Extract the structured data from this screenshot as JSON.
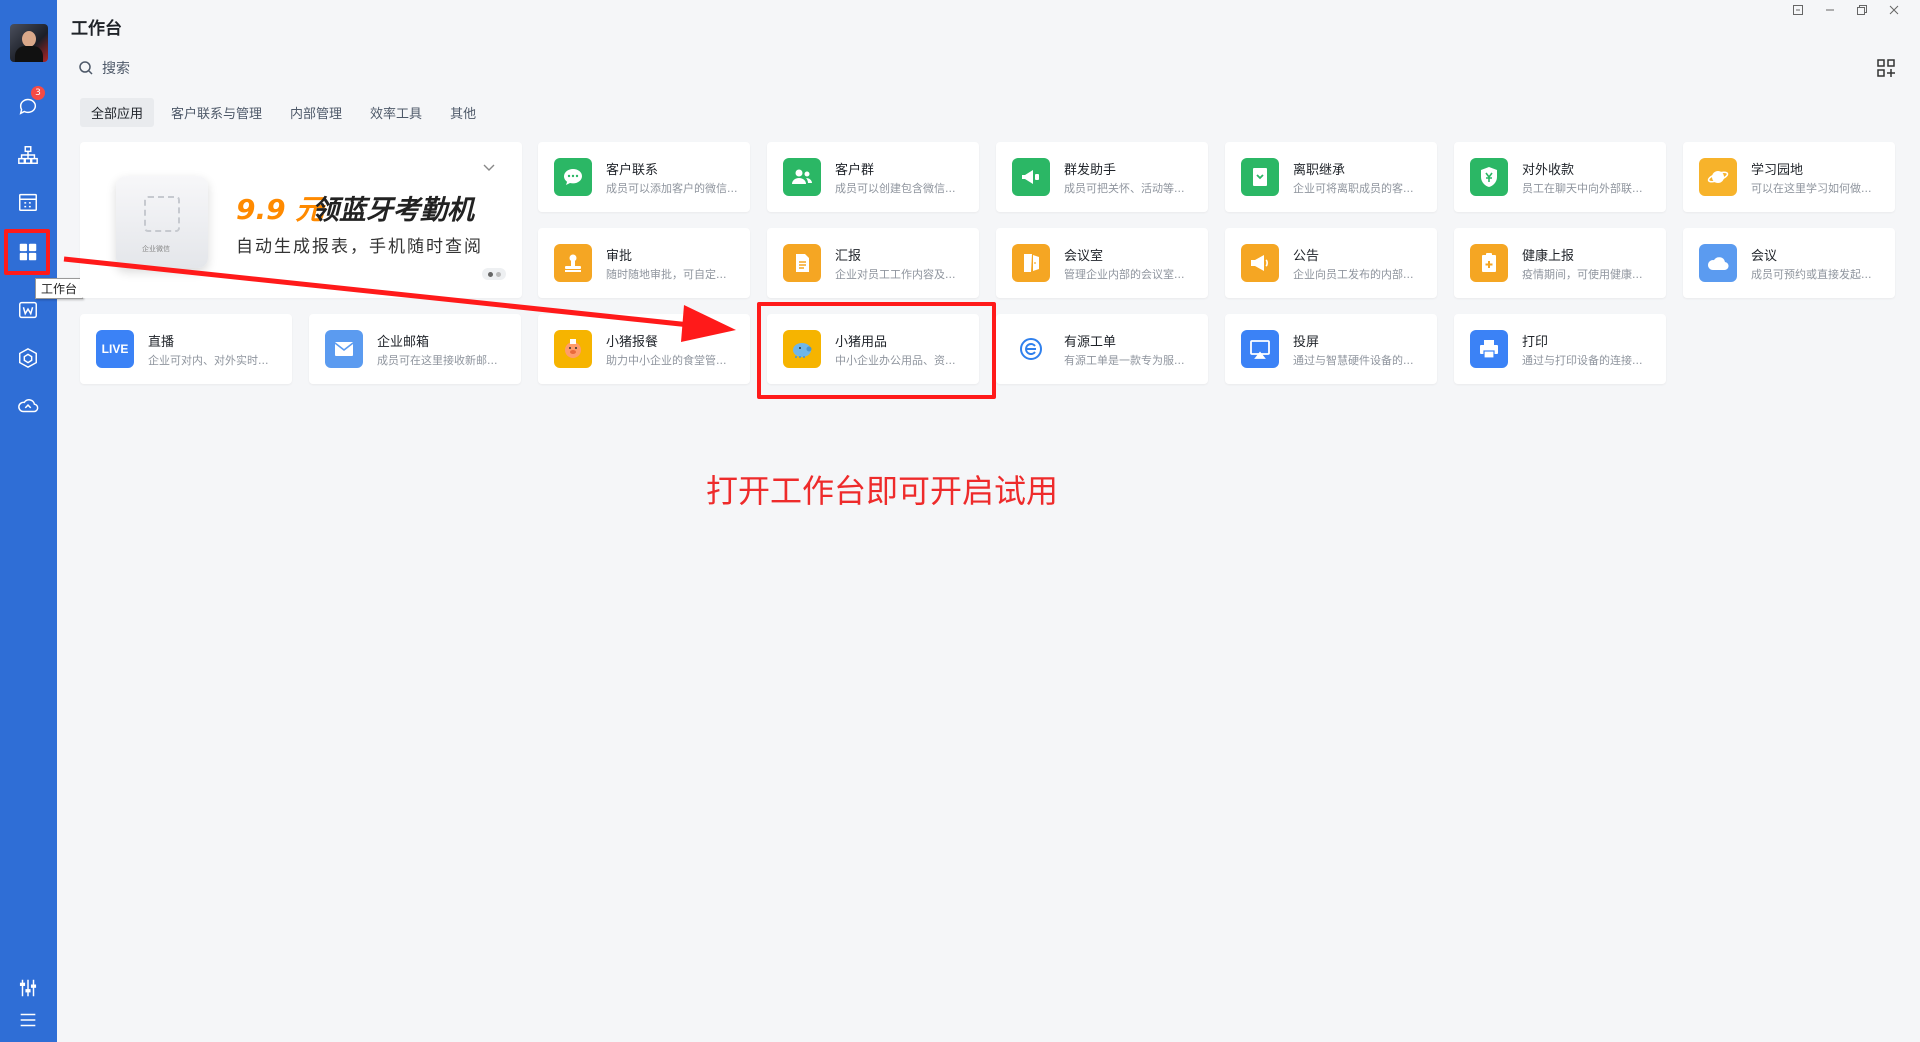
{
  "window": {
    "title": "工作台",
    "controls": [
      "pin",
      "minimize",
      "restore",
      "close"
    ]
  },
  "sidebar": {
    "badge_count": "3",
    "tooltip": "工作台",
    "items": [
      {
        "name": "messages-icon"
      },
      {
        "name": "contacts-icon"
      },
      {
        "name": "calendar-icon"
      },
      {
        "name": "workbench-icon",
        "active": true
      },
      {
        "name": "docs-icon"
      },
      {
        "name": "cube-icon"
      },
      {
        "name": "cloud-icon"
      },
      {
        "name": "settings-icon"
      },
      {
        "name": "menu-icon"
      }
    ]
  },
  "search": {
    "placeholder": "搜索"
  },
  "tabs": [
    "全部应用",
    "客户联系与管理",
    "内部管理",
    "效率工具",
    "其他"
  ],
  "banner": {
    "price": "9.9 元",
    "headline": "领蓝牙考勤机",
    "subline": "自动生成报表，手机随时查阅"
  },
  "apps": [
    {
      "name": "客户联系",
      "desc": "成员可以添加客户的微信...",
      "color": "#2bb765",
      "icon": "chat-icon"
    },
    {
      "name": "客户群",
      "desc": "成员可以创建包含微信...",
      "color": "#2bb765",
      "icon": "group-icon"
    },
    {
      "name": "群发助手",
      "desc": "成员可把关怀、活动等...",
      "color": "#2bb765",
      "icon": "megaphone-icon"
    },
    {
      "name": "离职继承",
      "desc": "企业可将离职成员的客...",
      "color": "#2bb765",
      "icon": "transfer-icon"
    },
    {
      "name": "对外收款",
      "desc": "员工在聊天中向外部联...",
      "color": "#2bb765",
      "icon": "yuan-icon"
    },
    {
      "name": "学习园地",
      "desc": "可以在这里学习如何做...",
      "color": "#f7b32b",
      "icon": "planet-icon"
    },
    {
      "name": "审批",
      "desc": "随时随地审批，可自定...",
      "color": "#f5a623",
      "icon": "stamp-icon"
    },
    {
      "name": "汇报",
      "desc": "企业对员工工作内容及...",
      "color": "#f5a623",
      "icon": "report-icon"
    },
    {
      "name": "会议室",
      "desc": "管理企业内部的会议室...",
      "color": "#f5a623",
      "icon": "door-icon"
    },
    {
      "name": "公告",
      "desc": "企业向员工发布的内部...",
      "color": "#f5a623",
      "icon": "announce-icon"
    },
    {
      "name": "健康上报",
      "desc": "疫情期间，可使用健康...",
      "color": "#f5a623",
      "icon": "health-icon"
    },
    {
      "name": "会议",
      "desc": "成员可预约或直接发起...",
      "color": "#5b9bf0",
      "icon": "meeting-cloud-icon"
    },
    {
      "name": "直播",
      "desc": "企业可对内、对外实时...",
      "color": "#3b82f6",
      "icon": "live-icon",
      "icon_text": "LIVE"
    },
    {
      "name": "企业邮箱",
      "desc": "成员可在这里接收新邮...",
      "color": "#5b9bf0",
      "icon": "mail-icon"
    },
    {
      "name": "小猪报餐",
      "desc": "助力中小企业的食堂管...",
      "color": "#f6b400",
      "icon": "pig-meal-icon"
    },
    {
      "name": "小猪用品",
      "desc": "中小企业办公用品、资...",
      "color": "#f6b400",
      "icon": "pig-supplies-icon"
    },
    {
      "name": "有源工单",
      "desc": "有源工单是一款专为服...",
      "color": "#ffffff",
      "icon": "e-logo-icon"
    },
    {
      "name": "投屏",
      "desc": "通过与智慧硬件设备的...",
      "color": "#3b82f6",
      "icon": "cast-icon"
    },
    {
      "name": "打印",
      "desc": "通过与打印设备的连接...",
      "color": "#3b82f6",
      "icon": "printer-icon"
    }
  ],
  "annotation": {
    "note": "打开工作台即可开启试用"
  }
}
